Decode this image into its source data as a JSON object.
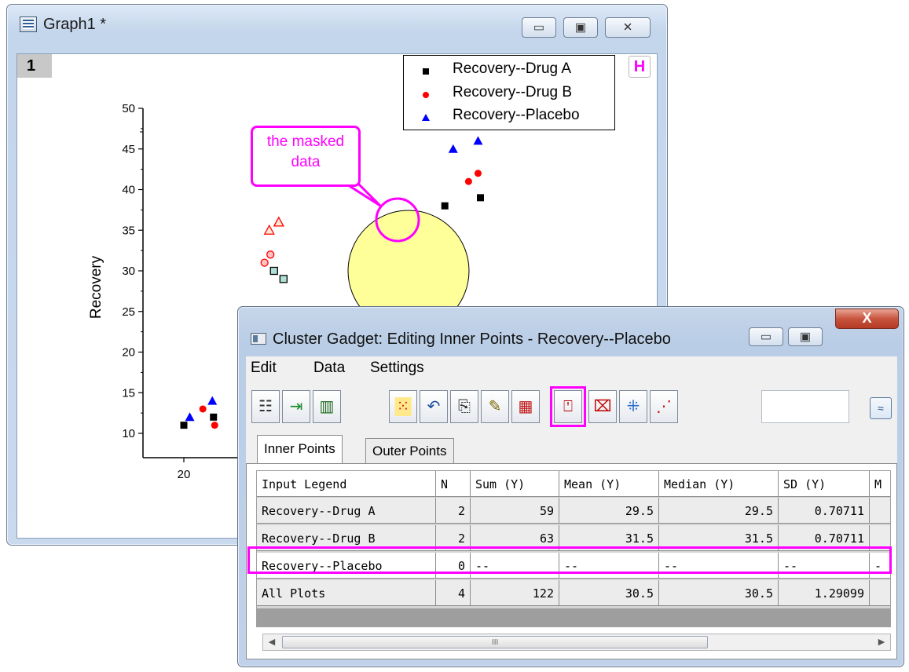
{
  "graph_window": {
    "title": "Graph1 *",
    "layer_label": "1",
    "h_button": "H",
    "minimize_glyph": "▭",
    "maximize_glyph": "▣",
    "close_glyph": "✕",
    "callout_text": "the masked data"
  },
  "chart_data": {
    "type": "scatter",
    "ylabel": "Recovery",
    "xlabel": "",
    "ylim": [
      8,
      50
    ],
    "y_ticks": [
      10,
      15,
      20,
      25,
      30,
      35,
      40,
      45,
      50
    ],
    "x_ticks": [
      20
    ],
    "legend_position": "top-right",
    "series": [
      {
        "name": "Recovery--Drug A",
        "marker": "square",
        "color": "#000000",
        "points": [
          [
            20,
            11
          ],
          [
            22.5,
            12
          ],
          [
            42,
            38
          ],
          [
            45,
            39
          ]
        ],
        "masked_points": [
          [
            27.6,
            30
          ],
          [
            28.4,
            29
          ]
        ]
      },
      {
        "name": "Recovery--Drug B",
        "marker": "circle",
        "color": "#ff0000",
        "points": [
          [
            21.6,
            13
          ],
          [
            22.6,
            11
          ],
          [
            44,
            41
          ],
          [
            44.8,
            42
          ]
        ],
        "masked_points": [
          [
            26.8,
            31
          ],
          [
            27.3,
            32
          ]
        ]
      },
      {
        "name": "Recovery--Placebo",
        "marker": "triangle",
        "color": "#0000ff",
        "points": [
          [
            20.5,
            12
          ],
          [
            22.4,
            14
          ],
          [
            42.7,
            45
          ],
          [
            44.8,
            46
          ]
        ],
        "masked_points": [
          [
            27.2,
            35
          ],
          [
            28.0,
            36
          ]
        ]
      }
    ]
  },
  "gadget_window": {
    "title": "Cluster Gadget: Editing Inner Points - Recovery--Placebo",
    "menu": [
      "Edit",
      "Data",
      "Settings"
    ],
    "tab_inner": "Inner Points",
    "tab_outer": "Outer Points",
    "expand_glyph": "≈",
    "close_glyph": "X",
    "scroll_left": "◀",
    "scroll_right": "▶",
    "scroll_grip": "III",
    "columns": [
      "Input Legend",
      "N",
      "Sum (Y)",
      "Mean (Y)",
      "Median (Y)",
      "SD (Y)",
      "M"
    ],
    "rows": [
      [
        "Recovery--Drug A",
        "2",
        "59",
        "29.5",
        "29.5",
        "0.70711",
        ""
      ],
      [
        "Recovery--Drug B",
        "2",
        "63",
        "31.5",
        "31.5",
        "0.70711",
        ""
      ],
      [
        "Recovery--Placebo",
        "0",
        "--",
        "--",
        "--",
        "--",
        "-"
      ],
      [
        "All Plots",
        "4",
        "122",
        "30.5",
        "30.5",
        "1.29099",
        ""
      ]
    ]
  }
}
